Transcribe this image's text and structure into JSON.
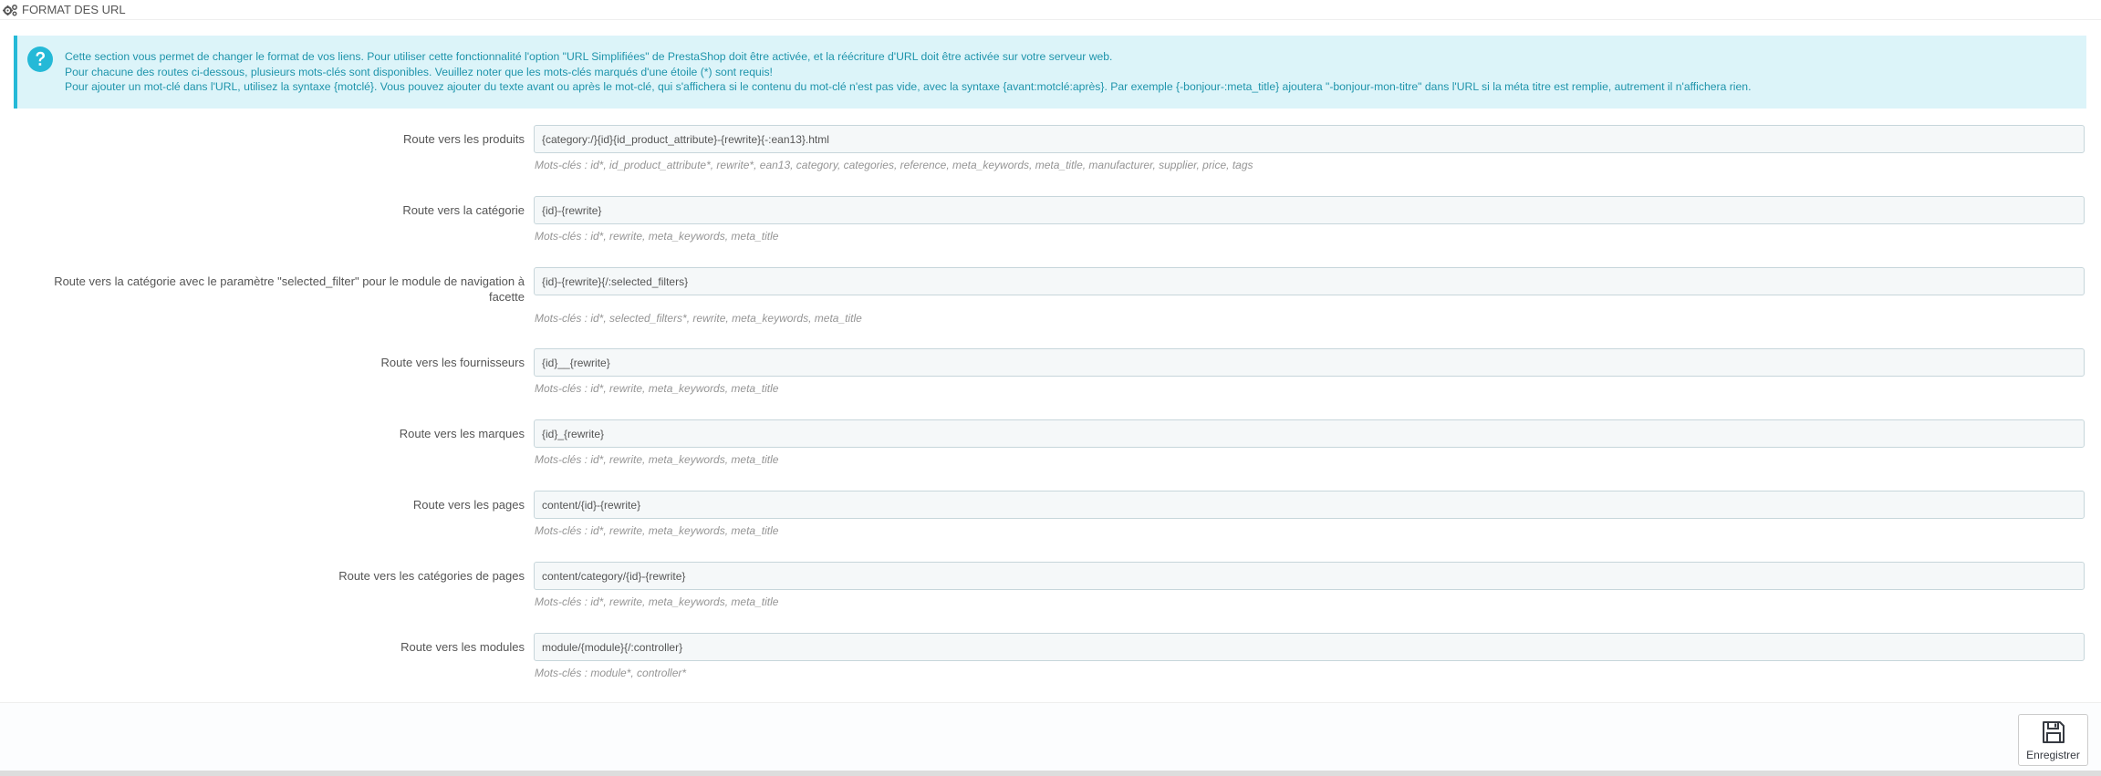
{
  "panel": {
    "title": "FORMAT DES URL",
    "title_icon": "cogs-icon"
  },
  "alert": {
    "icon": "question-circle-icon",
    "lines": [
      "Cette section vous permet de changer le format de vos liens. Pour utiliser cette fonctionnalité l'option \"URL Simplifiées\" de PrestaShop doit être activée, et la réécriture d'URL doit être activée sur votre serveur web.",
      "Pour chacune des routes ci-dessous, plusieurs mots-clés sont disponibles. Veuillez noter que les mots-clés marqués d'une étoile (*) sont requis!",
      "Pour ajouter un mot-clé dans l'URL, utilisez la syntaxe {motclé}. Vous pouvez ajouter du texte avant ou après le mot-clé, qui s'affichera si le contenu du mot-clé n'est pas vide, avec la syntaxe {avant:motclé:après}. Par exemple {-bonjour-:meta_title} ajoutera \"-bonjour-mon-titre\" dans l'URL si la méta titre est remplie, autrement il n'affichera rien."
    ]
  },
  "routes": [
    {
      "label": "Route vers les produits",
      "value": "{category:/}{id}{id_product_attribute}-{rewrite}{-:ean13}.html",
      "help": "Mots-clés : id*, id_product_attribute*, rewrite*, ean13, category, categories, reference, meta_keywords, meta_title, manufacturer, supplier, price, tags"
    },
    {
      "label": "Route vers la catégorie",
      "value": "{id}-{rewrite}",
      "help": "Mots-clés : id*, rewrite, meta_keywords, meta_title"
    },
    {
      "label_line1": "Route vers la catégorie avec le paramètre \"selected_filter\" pour le module de navigation à",
      "label_line2": "facette",
      "value": "{id}-{rewrite}{/:selected_filters}",
      "help": "Mots-clés : id*, selected_filters*, rewrite, meta_keywords, meta_title"
    },
    {
      "label": "Route vers les fournisseurs",
      "value": "{id}__{rewrite}",
      "help": "Mots-clés : id*, rewrite, meta_keywords, meta_title"
    },
    {
      "label": "Route vers les marques",
      "value": "{id}_{rewrite}",
      "help": "Mots-clés : id*, rewrite, meta_keywords, meta_title"
    },
    {
      "label": "Route vers les pages",
      "value": "content/{id}-{rewrite}",
      "help": "Mots-clés : id*, rewrite, meta_keywords, meta_title"
    },
    {
      "label": "Route vers les catégories de pages",
      "value": "content/category/{id}-{rewrite}",
      "help": "Mots-clés : id*, rewrite, meta_keywords, meta_title"
    },
    {
      "label": "Route vers les modules",
      "value": "module/{module}{/:controller}",
      "help": "Mots-clés : module*, controller*"
    }
  ],
  "footer": {
    "save_label": "Enregistrer",
    "save_icon": "floppy-disk-icon"
  },
  "colors": {
    "alert_bg": "#dcf4f9",
    "alert_border": "#25b9d7",
    "alert_text": "#1e94ab",
    "input_bg": "#f5f8f9",
    "input_border": "#c7d6db"
  }
}
